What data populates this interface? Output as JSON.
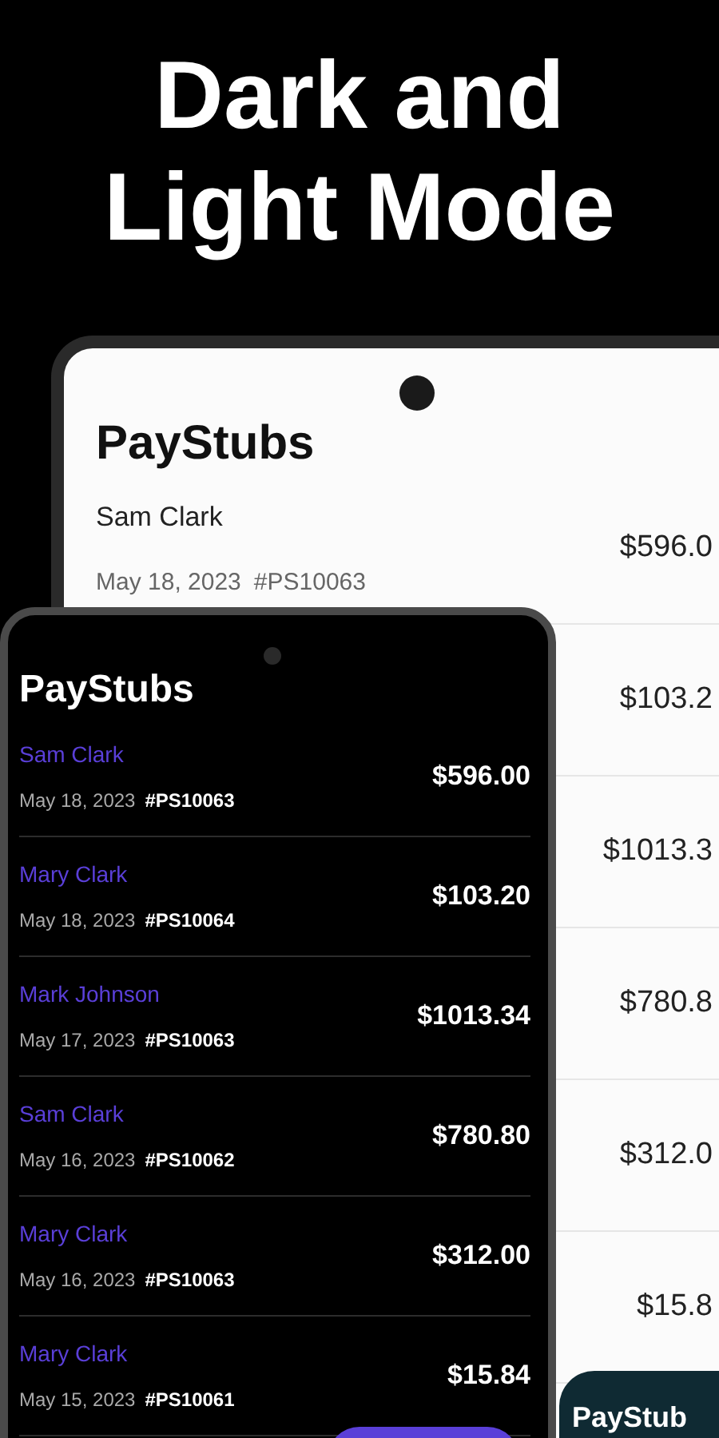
{
  "headline": "Dark and Light Mode",
  "light_phone": {
    "title": "PayStubs",
    "rows": [
      {
        "name": "Sam Clark",
        "date": "May 18, 2023",
        "id": "#PS10063",
        "amount": "$596.0"
      },
      {
        "amount": "$103.2"
      },
      {
        "amount": "$1013.3"
      },
      {
        "amount": "$780.8"
      },
      {
        "amount": "$312.0"
      },
      {
        "amount": "$15.8"
      }
    ],
    "button": "PayStub"
  },
  "dark_phone": {
    "title": "PayStubs",
    "rows": [
      {
        "name": "Sam Clark",
        "date": "May 18, 2023",
        "id": "#PS10063",
        "amount": "$596.00"
      },
      {
        "name": "Mary Clark",
        "date": "May 18, 2023",
        "id": "#PS10064",
        "amount": "$103.20"
      },
      {
        "name": "Mark Johnson",
        "date": "May 17, 2023",
        "id": "#PS10063",
        "amount": "$1013.34"
      },
      {
        "name": "Sam Clark",
        "date": "May 16, 2023",
        "id": "#PS10062",
        "amount": "$780.80"
      },
      {
        "name": "Mary Clark",
        "date": "May 16, 2023",
        "id": "#PS10063",
        "amount": "$312.00"
      },
      {
        "name": "Mary Clark",
        "date": "May 15, 2023",
        "id": "#PS10061",
        "amount": "$15.84"
      }
    ]
  }
}
